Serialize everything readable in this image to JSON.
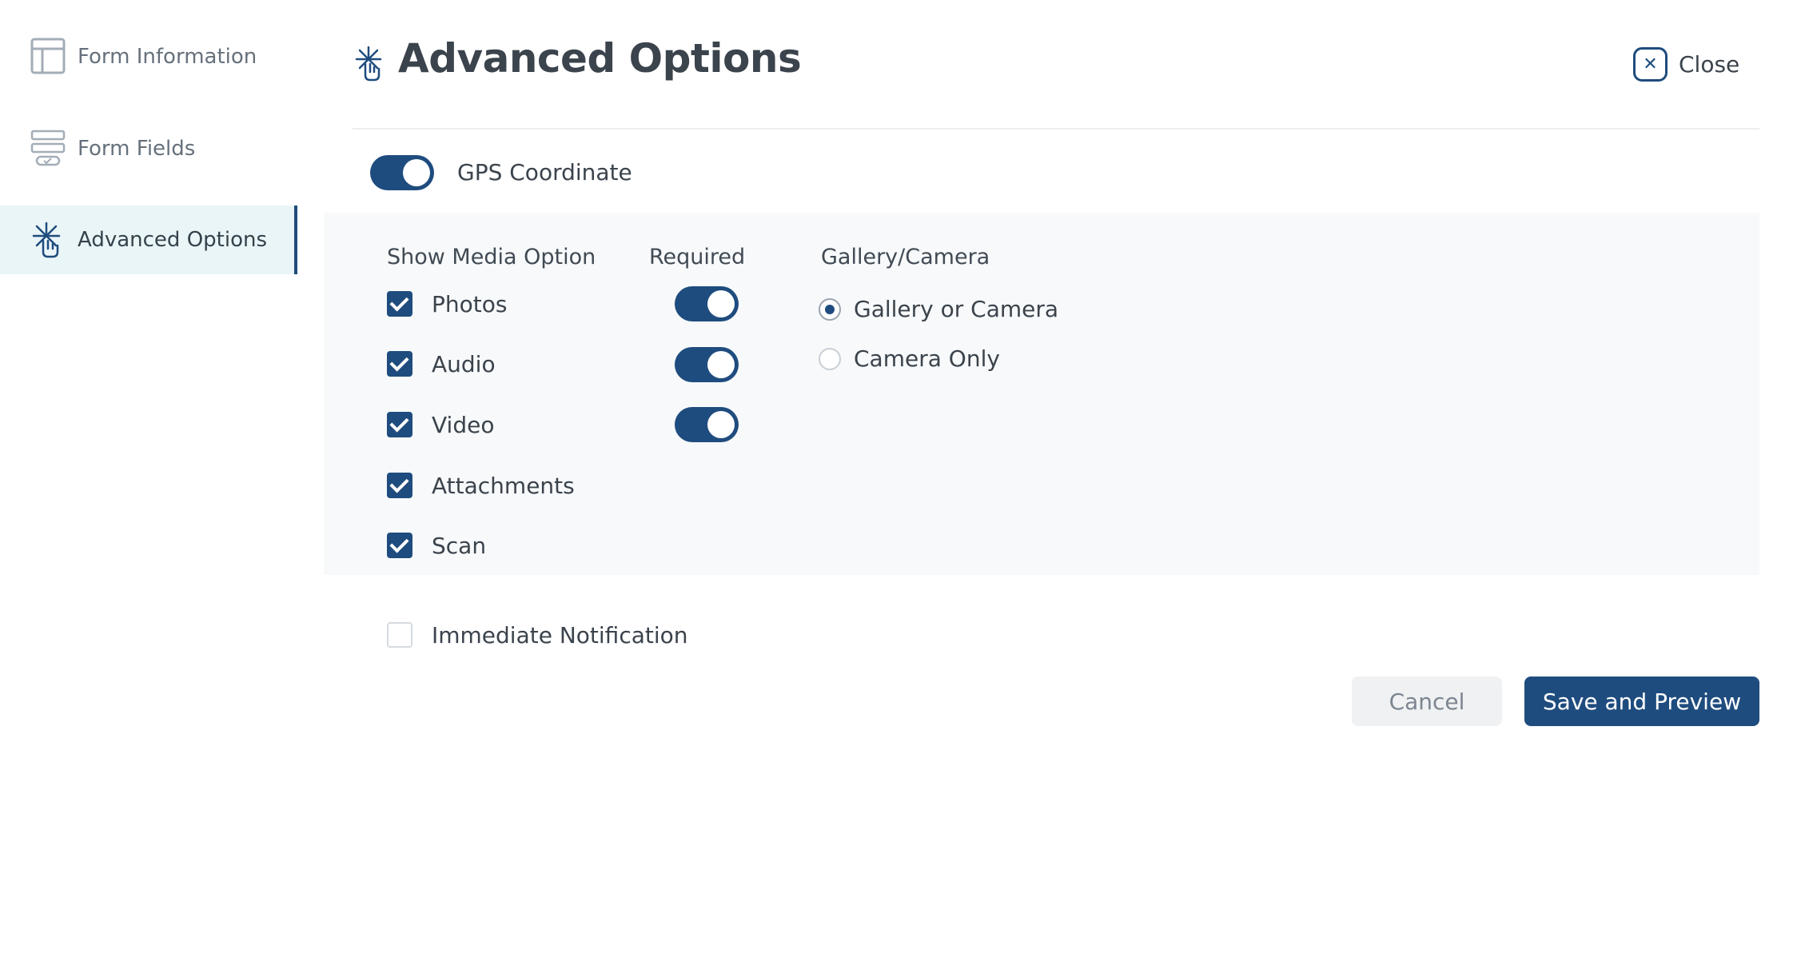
{
  "sidebar": {
    "items": [
      {
        "label": "Form Information",
        "icon": "layout-icon"
      },
      {
        "label": "Form Fields",
        "icon": "form-fields-icon"
      },
      {
        "label": "Advanced Options",
        "icon": "advanced-options-icon",
        "active": true
      }
    ]
  },
  "header": {
    "title": "Advanced Options",
    "icon": "advanced-options-icon",
    "close_label": "Close",
    "close_icon": "close-icon"
  },
  "gps": {
    "label": "GPS Coordinate",
    "enabled": true
  },
  "media": {
    "show_media_header": "Show Media Option",
    "required_header": "Required",
    "gallery_header": "Gallery/Camera",
    "options": [
      {
        "label": "Photos",
        "checked": true,
        "required": true
      },
      {
        "label": "Audio",
        "checked": true,
        "required": true
      },
      {
        "label": "Video",
        "checked": true,
        "required": true
      },
      {
        "label": "Attachments",
        "checked": true
      },
      {
        "label": "Scan",
        "checked": true
      }
    ],
    "gallery_options": [
      {
        "label": "Gallery or Camera",
        "selected": true
      },
      {
        "label": "Camera Only",
        "selected": false
      }
    ]
  },
  "notification": {
    "label": "Immediate Notification",
    "checked": false
  },
  "actions": {
    "cancel_label": "Cancel",
    "save_label": "Save and Preview"
  },
  "colors": {
    "accent": "#1f4c7e",
    "active_bg": "#eaf5f7",
    "panel_bg": "#f7f9fa"
  }
}
